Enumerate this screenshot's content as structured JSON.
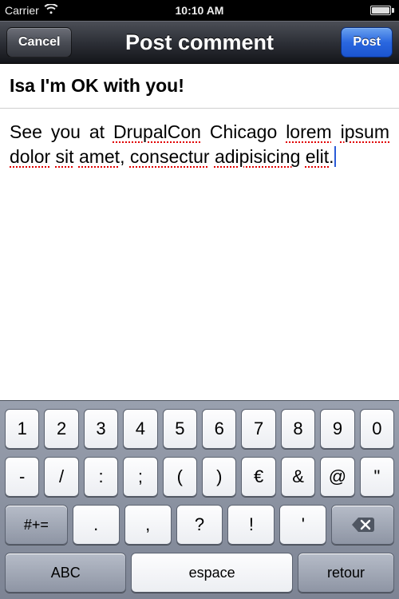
{
  "status": {
    "carrier": "Carrier",
    "time": "10:10 AM"
  },
  "nav": {
    "cancel_label": "Cancel",
    "title": "Post comment",
    "post_label": "Post"
  },
  "comment": {
    "subject": "Isa I'm OK with you!",
    "body_prefix": "See you at ",
    "body_word_drupalcon": "DrupalCon",
    "body_word_chicago": " Chicago ",
    "body_lorem": "lorem",
    "body_sp1": " ",
    "body_ipsum": "ipsum",
    "body_sp2": " ",
    "body_dolor": "dolor",
    "body_sp3": " ",
    "body_sit": "sit",
    "body_sp4": " ",
    "body_amet": "amet",
    "body_comma": ", ",
    "body_consectur": "consectur",
    "body_sp5": " ",
    "body_adipisicing": "adipisicing",
    "body_sp6": " ",
    "body_elit": "elit",
    "body_period": "."
  },
  "keyboard": {
    "row1": [
      "1",
      "2",
      "3",
      "4",
      "5",
      "6",
      "7",
      "8",
      "9",
      "0"
    ],
    "row2": [
      "-",
      "/",
      ":",
      ";",
      "(",
      ")",
      "€",
      "&",
      "@",
      "\""
    ],
    "row3_alt": "#+=",
    "row3_keys": [
      ".",
      ",",
      "?",
      "!",
      "'"
    ],
    "row4_abc": "ABC",
    "row4_space": "espace",
    "row4_return": "retour"
  }
}
